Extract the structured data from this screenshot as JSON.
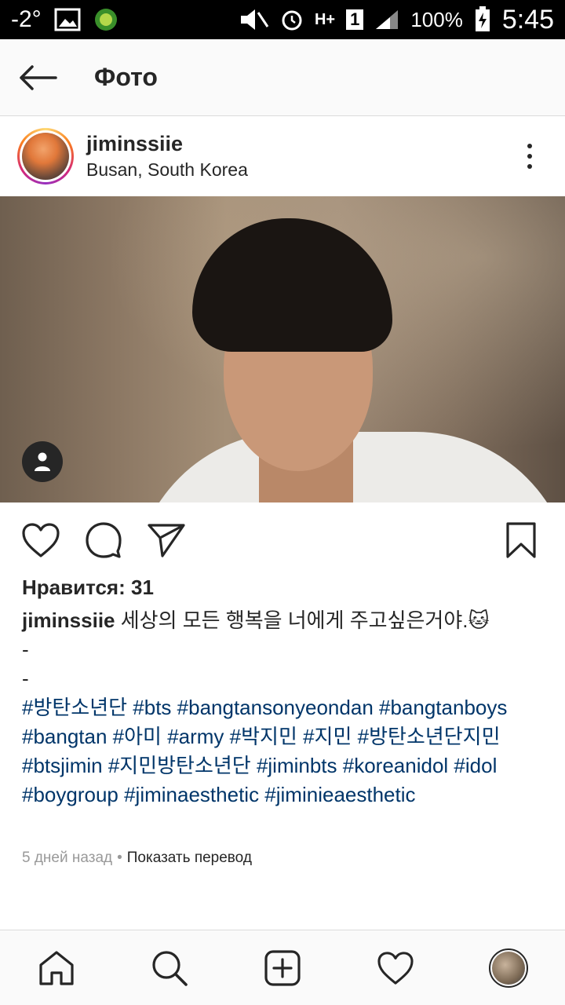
{
  "status_bar": {
    "temperature": "-2°",
    "network": "H+",
    "sim": "1",
    "battery": "100%",
    "time": "5:45"
  },
  "app_bar": {
    "title": "Фото"
  },
  "post": {
    "username": "jiminssiie",
    "location": "Busan, South Korea",
    "likes_label": "Нравится: 31",
    "caption_user": "jiminssiie",
    "caption_text": " 세상의 모든 행복을 너에게 주고싶은거야.",
    "caption_emoji": "🐱",
    "dash1": "-",
    "dash2": "-",
    "hashtags": "#방탄소년단 #bts #bangtansonyeondan #bangtanboys #bangtan #아미 #army #박지민 #지민 #방탄소년단지민 #btsjimin #지민방탄소년단 #jiminbts #koreanidol #idol #boygroup #jiminaesthetic #jiminieaesthetic",
    "time_ago": "5 дней назад",
    "separator": "•",
    "translate_label": "Показать перевод"
  },
  "icons": {
    "back": "back-arrow-icon",
    "more": "more-vertical-icon",
    "like": "heart-icon",
    "comment": "comment-icon",
    "share": "send-icon",
    "save": "bookmark-icon",
    "home": "home-icon",
    "search": "search-icon",
    "add": "add-icon",
    "activity": "heart-icon"
  }
}
